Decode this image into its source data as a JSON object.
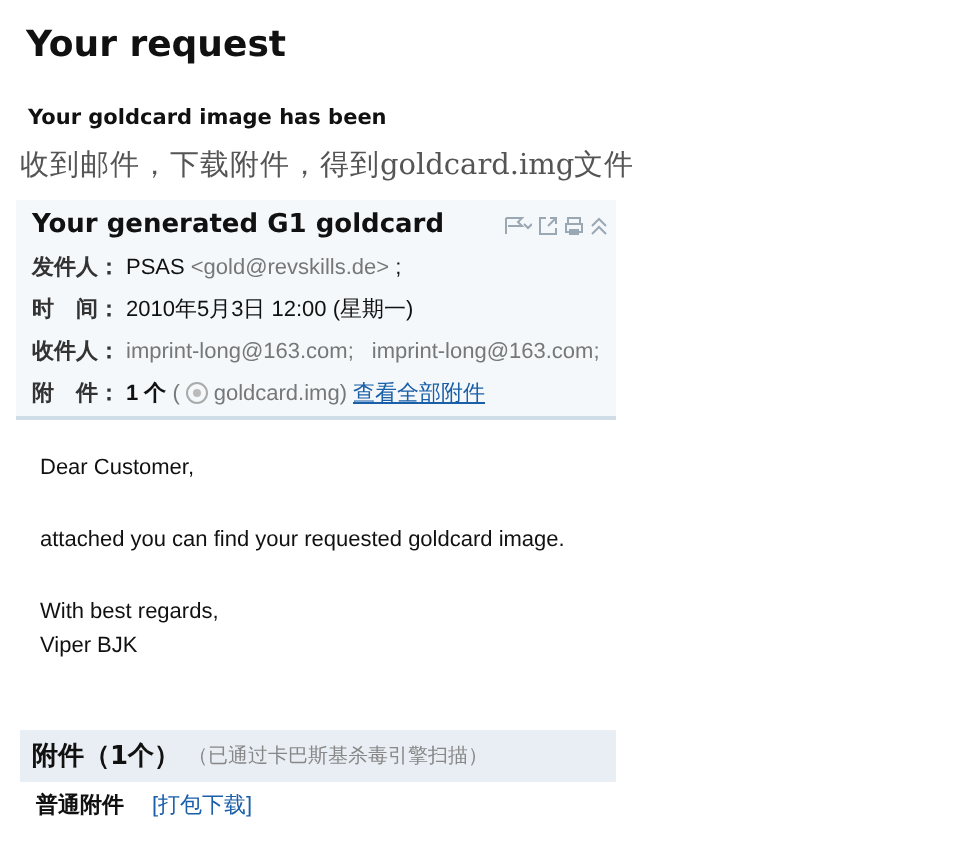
{
  "page_title": "Your request",
  "notice": "Your goldcard image has been",
  "caption": "收到邮件，下载附件，得到goldcard.img文件",
  "email": {
    "subject": "Your generated G1 goldcard",
    "fields": [
      {
        "label": "发件人：",
        "kind": "sender",
        "name": "PSAS",
        "address": "<gold@revskills.de>",
        "suffix": ";"
      },
      {
        "label": "时　间：",
        "kind": "plain",
        "value": "2010年5月3日 12:00 (星期一)"
      },
      {
        "label": "收件人：",
        "kind": "recipients",
        "values": [
          "imprint-long@163.com;",
          "imprint-long@163.com;"
        ]
      },
      {
        "label": "附　件：",
        "kind": "attachment",
        "count": "1 个",
        "open": "(",
        "file": "goldcard.img)",
        "link": "查看全部附件"
      }
    ],
    "body": [
      "Dear Customer,",
      "attached you can find your requested goldcard image.",
      "With best regards,",
      "Viper BJK"
    ]
  },
  "attachments": {
    "title": "附件（1个）",
    "note": "（已通过卡巴斯基杀毒引擎扫描）",
    "group": "普通附件",
    "action": "[打包下载]"
  }
}
